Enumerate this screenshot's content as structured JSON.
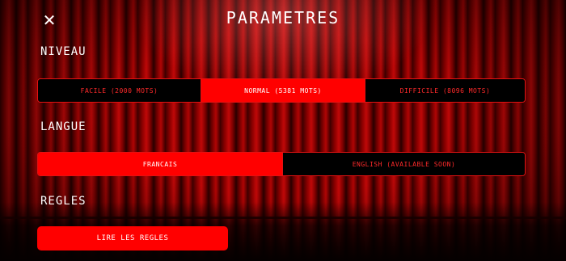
{
  "title": "PARAMETRES",
  "close_icon": "close-icon",
  "colors": {
    "accent": "#ff0000",
    "border": "#e31212",
    "inactive_text": "#ff2a2a",
    "panel": "#000000"
  },
  "sections": {
    "niveau": {
      "label": "NIVEAU",
      "options": [
        "FACILE (2000 MOTS)",
        "NORMAL (5381 MOTS)",
        "DIFFICILE (8096 MOTS)"
      ],
      "selected": "NORMAL (5381 MOTS)"
    },
    "langue": {
      "label": "LANGUE",
      "options": [
        "FRANCAIS",
        "ENGLISH (AVAILABLE SOON)"
      ],
      "selected": "FRANCAIS"
    },
    "regles": {
      "label": "REGLES",
      "button": "LIRE LES REGLES"
    }
  }
}
